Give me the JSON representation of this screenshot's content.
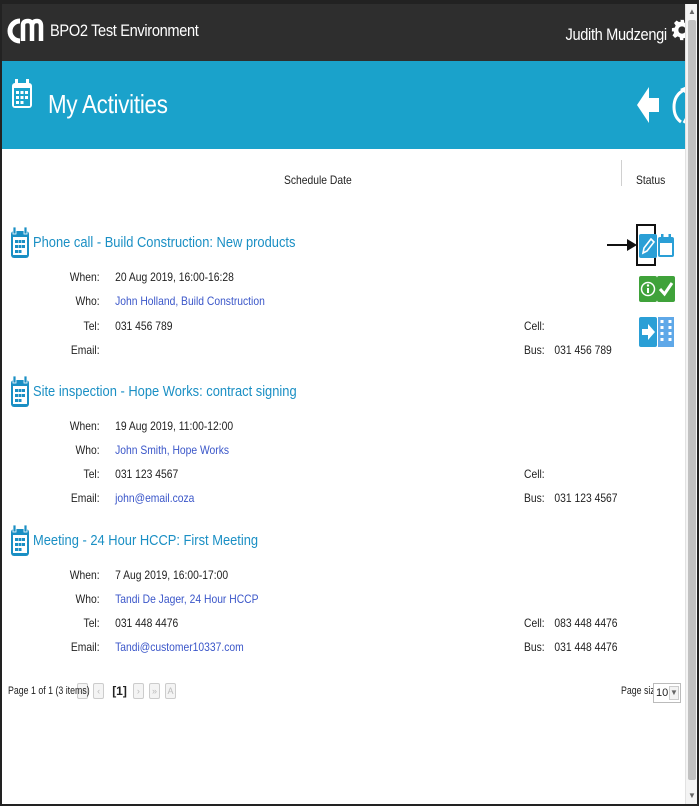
{
  "app": {
    "environment": "BPO2 Test Environment",
    "user": "Judith Mudzengi"
  },
  "page": {
    "title": "My Activities"
  },
  "columns": {
    "schedule_date": "Schedule Date",
    "status": "Status"
  },
  "labels": {
    "when": "When:",
    "who": "Who:",
    "tel": "Tel:",
    "email": "Email:",
    "cell": "Cell:",
    "bus": "Bus:"
  },
  "activities": [
    {
      "title": "Phone call - Build Construction: New products",
      "when": "20 Aug 2019, 16:00-16:28",
      "who": "John Holland, Build Construction",
      "tel": "031 456 789",
      "email": "",
      "cell": "",
      "bus": "031 456 789"
    },
    {
      "title": "Site inspection - Hope Works: contract signing",
      "when": "19 Aug 2019, 11:00-12:00",
      "who": "John Smith, Hope Works",
      "tel": "031 123 4567",
      "email": "john@email.coza",
      "cell": "",
      "bus": "031 123 4567"
    },
    {
      "title": "Meeting - 24 Hour HCCP: First Meeting",
      "when": "7 Aug 2019, 16:00-17:00",
      "who": "Tandi De Jager, 24 Hour HCCP",
      "tel": "031 448 4476",
      "email": "Tandi@customer10337.com",
      "cell": "083 448 4476",
      "bus": "031 448 4476"
    }
  ],
  "pager": {
    "info": "Page 1 of 1 (3 items)",
    "current": "[1]",
    "page_size_label": "Page size:",
    "page_size_value": "10"
  },
  "icons": {
    "logo": "crm-logo",
    "settings": "gear-icon",
    "page": "calendar-icon",
    "back": "back-arrow-icon",
    "refresh": "refresh-icon",
    "status_actions": [
      "edit-icon",
      "calendar-icon",
      "info-icon",
      "complete-check-icon",
      "forward-icon",
      "building-icon"
    ]
  },
  "colors": {
    "topbar": "#2e2e2e",
    "titlebar": "#1aa2cb",
    "link": "#3a56c9",
    "title_link": "#1a8fc4",
    "status_green": "#3fa23a",
    "status_blue": "#2a9fd6"
  }
}
